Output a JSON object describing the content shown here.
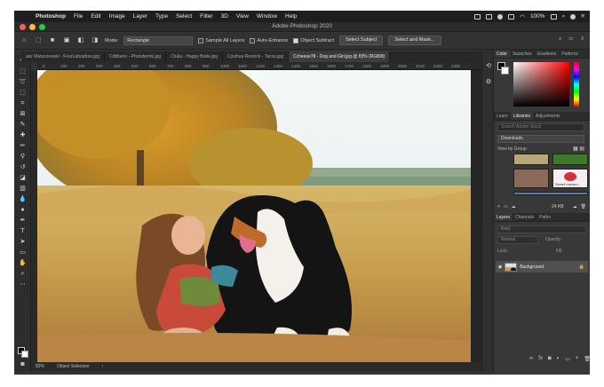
{
  "menubar": {
    "app": "Photoshop",
    "items": [
      "File",
      "Edit",
      "Image",
      "Layer",
      "Type",
      "Select",
      "Filter",
      "3D",
      "View",
      "Window",
      "Help"
    ],
    "battery": "100%",
    "icons": [
      "apple-icon",
      "wifi-icon",
      "battery-icon",
      "search-icon",
      "user-icon",
      "menu-icon"
    ]
  },
  "window": {
    "title": "Adobe Photoshop 2020"
  },
  "options": {
    "mode_label": "Mode:",
    "mode_value": "Rectangle",
    "sample_all_layers": "Sample All Layers",
    "auto_enhance": "Auto-Enhance",
    "object_subtract": "Object Subtract",
    "select_subject": "Select Subject",
    "select_and_mask": "Select and Mask...",
    "checks": {
      "sample_all_layers": false,
      "auto_enhance": false,
      "object_subtract": true
    }
  },
  "tabs": [
    {
      "label": "asz Matuszewski - FourLabradors.jpg"
    },
    {
      "label": "Cdtiberio - Photobomb.jpg"
    },
    {
      "label": "Ctulia - Happy Bride.jpg"
    },
    {
      "label": "Cjoshua Resnick - Tacos.jpg"
    },
    {
      "label": "Ccheese78 - Dog and Girl.jpg @ 83% (RGB/8)"
    }
  ],
  "ruler": {
    "ticks": [
      "0",
      "100",
      "200",
      "300",
      "400",
      "500",
      "600",
      "700",
      "800",
      "900",
      "1000",
      "1100",
      "1200",
      "1300",
      "1400",
      "1500",
      "1600",
      "1700",
      "1800",
      "1900",
      "2000",
      "2100",
      "2200",
      "2300"
    ]
  },
  "status": {
    "zoom": "83%",
    "tool": "Object Selection",
    "arrow": "›"
  },
  "panels": {
    "color_tabs": [
      "Color",
      "Swatches",
      "Gradients",
      "Patterns"
    ],
    "library_tabs": [
      "Learn",
      "Libraries",
      "Adjustments"
    ],
    "library": {
      "search_placeholder": "Search Adobe Stock",
      "selected": "Downloads",
      "view_by": "View by Group",
      "thumb_caption": "Sweet macaro...",
      "size": "24 KB"
    },
    "layers_tabs": [
      "Layers",
      "Channels",
      "Paths"
    ],
    "layers": {
      "kind_placeholder": "Kind",
      "blend_mode": "Normal",
      "opacity_label": "Opacity:",
      "lock_label": "Lock:",
      "fill_label": "Fill:",
      "background_layer": "Background"
    }
  }
}
